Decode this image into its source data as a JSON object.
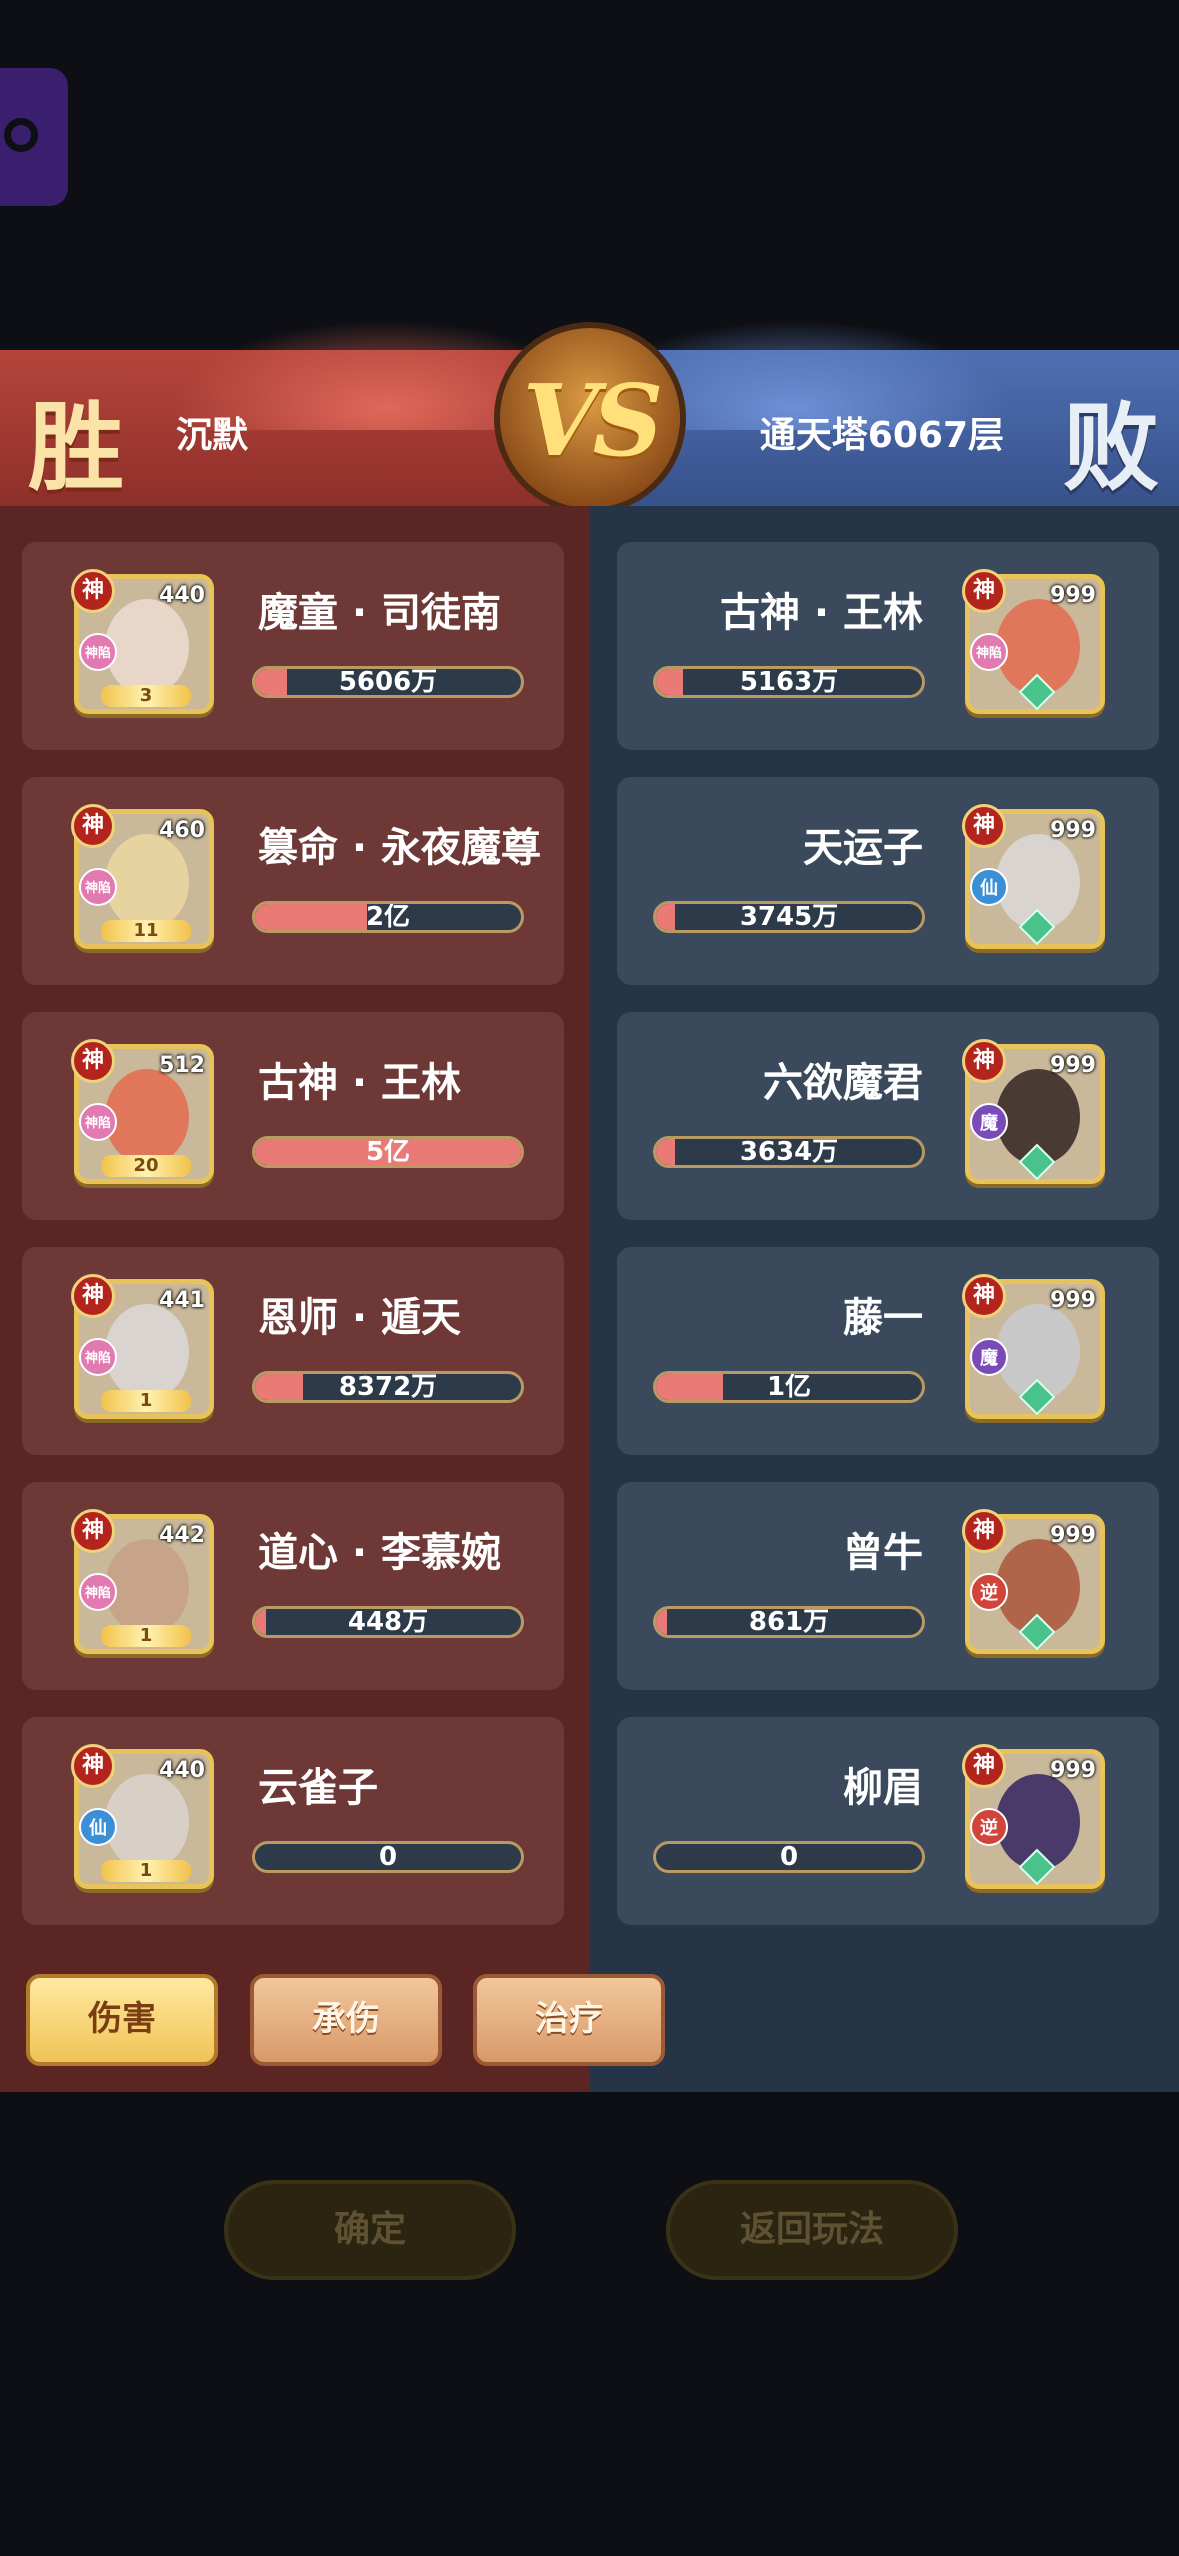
{
  "header": {
    "win_label": "胜",
    "lose_label": "败",
    "vs_label": "VS",
    "left_player": "沉默",
    "right_player": "通天塔6067层"
  },
  "left_team": [
    {
      "name": "魔童 · 司徒南",
      "level": "440",
      "rank": "神",
      "faction": "神陷",
      "stars": "3",
      "damage": "5606万",
      "fill": 0.12,
      "face": "#e8d7c8"
    },
    {
      "name": "篡命 · 永夜魔尊",
      "level": "460",
      "rank": "神",
      "faction": "神陷",
      "stars": "11",
      "damage": "2亿",
      "fill": 0.42,
      "face": "#e6d3a0"
    },
    {
      "name": "古神 · 王林",
      "level": "512",
      "rank": "神",
      "faction": "神陷",
      "stars": "20",
      "damage": "5亿",
      "fill": 1.0,
      "face": "#e0775a"
    },
    {
      "name": "恩师 · 遁天",
      "level": "441",
      "rank": "神",
      "faction": "神陷",
      "stars": "1",
      "damage": "8372万",
      "fill": 0.18,
      "face": "#d9d4cf"
    },
    {
      "name": "道心 · 李慕婉",
      "level": "442",
      "rank": "神",
      "faction": "神陷",
      "stars": "1",
      "damage": "448万",
      "fill": 0.01,
      "face": "#c7a38a"
    },
    {
      "name": "云雀子",
      "level": "440",
      "rank": "神",
      "faction": "仙",
      "stars": "1",
      "damage": "0",
      "fill": 0.0,
      "face": "#d8d0c6"
    }
  ],
  "right_team": [
    {
      "name": "古神 · 王林",
      "level": "999",
      "rank": "神",
      "faction": "神陷",
      "damage": "5163万",
      "fill": 0.1,
      "face": "#e0775a"
    },
    {
      "name": "天运子",
      "level": "999",
      "rank": "神",
      "faction": "仙",
      "damage": "3745万",
      "fill": 0.07,
      "face": "#d9d4cf"
    },
    {
      "name": "六欲魔君",
      "level": "999",
      "rank": "神",
      "faction": "魔",
      "damage": "3634万",
      "fill": 0.07,
      "face": "#4a3a34"
    },
    {
      "name": "藤一",
      "level": "999",
      "rank": "神",
      "faction": "魔",
      "damage": "1亿",
      "fill": 0.25,
      "face": "#c8c8c8"
    },
    {
      "name": "曾牛",
      "level": "999",
      "rank": "神",
      "faction": "逆",
      "damage": "861万",
      "fill": 0.01,
      "face": "#b0644a"
    },
    {
      "name": "柳眉",
      "level": "999",
      "rank": "神",
      "faction": "逆",
      "damage": "0",
      "fill": 0.0,
      "face": "#4a3a6a"
    }
  ],
  "tabs": [
    {
      "label": "伤害",
      "active": true
    },
    {
      "label": "承伤",
      "active": false
    },
    {
      "label": "治疗",
      "active": false
    }
  ],
  "bottom": {
    "confirm": "确定",
    "back": "返回玩法"
  },
  "colors": {
    "win_panel": "#5a2523",
    "lose_panel": "#253447",
    "bar_fill": "#e97a76"
  }
}
